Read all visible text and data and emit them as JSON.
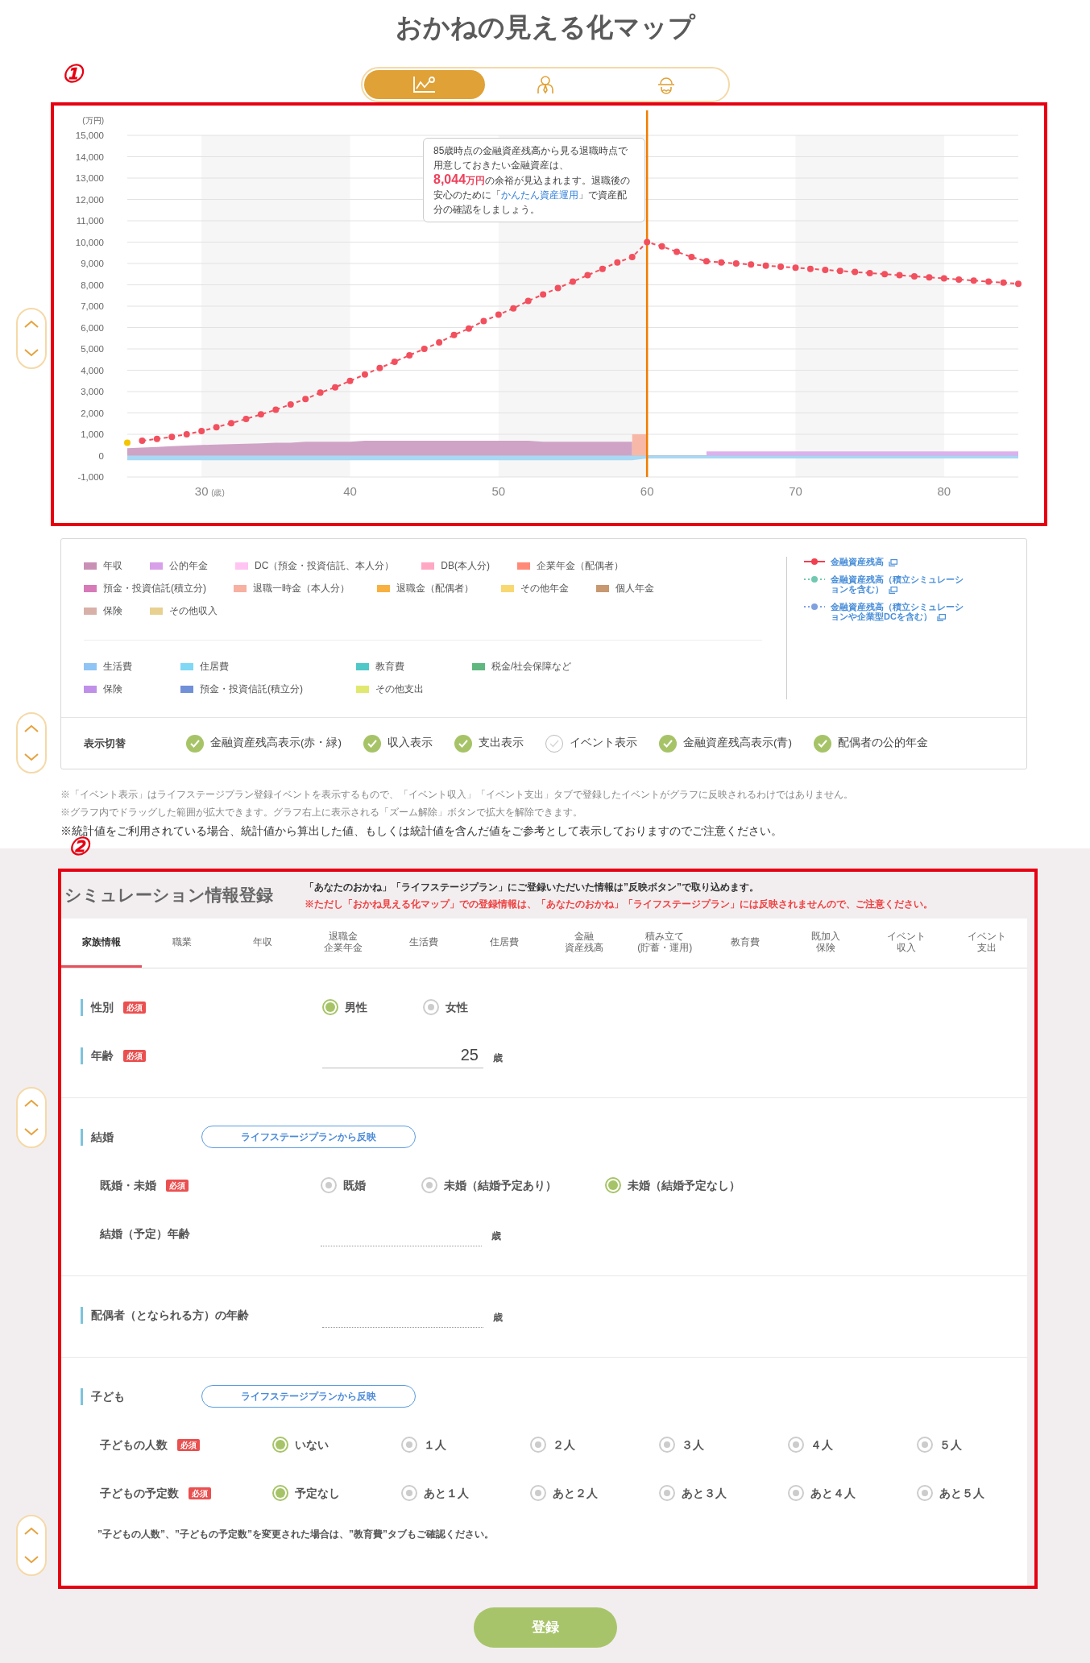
{
  "title": "おかねの見える化マップ",
  "view_tabs": [
    {
      "kind": "chart",
      "selected": true
    },
    {
      "kind": "person",
      "selected": false
    },
    {
      "kind": "advisor",
      "selected": false
    }
  ],
  "chart_section": {
    "marker": "①",
    "chart_data": {
      "type": "line",
      "xlabel": "(歳)",
      "ylabel": "(万円)",
      "stacked": false,
      "x": [
        25,
        26,
        27,
        28,
        29,
        30,
        31,
        32,
        33,
        34,
        35,
        36,
        37,
        38,
        39,
        40,
        41,
        42,
        43,
        44,
        45,
        46,
        47,
        48,
        49,
        50,
        51,
        52,
        53,
        54,
        55,
        56,
        57,
        58,
        59,
        60,
        61,
        62,
        63,
        64,
        65,
        66,
        67,
        68,
        69,
        70,
        71,
        72,
        73,
        74,
        75,
        76,
        77,
        78,
        79,
        80,
        81,
        82,
        83,
        84,
        85
      ],
      "xlim": [
        25,
        85
      ],
      "ylim": [
        -1000,
        15000
      ],
      "grid": true,
      "xticks": [
        30,
        40,
        50,
        60,
        70,
        80
      ],
      "yticks": [
        {
          "value": 15000,
          "label": "15,000"
        },
        {
          "value": 14000,
          "label": "14,000"
        },
        {
          "value": 13000,
          "label": "13,000"
        },
        {
          "value": 12000,
          "label": "12,000"
        },
        {
          "value": 11000,
          "label": "11,000"
        },
        {
          "value": 10000,
          "label": "10,000"
        },
        {
          "value": 9000,
          "label": "9,000"
        },
        {
          "value": 8000,
          "label": "8,000"
        },
        {
          "value": 7000,
          "label": "7,000"
        },
        {
          "value": 6000,
          "label": "6,000"
        },
        {
          "value": 5000,
          "label": "5,000"
        },
        {
          "value": 4000,
          "label": "4,000"
        },
        {
          "value": 3000,
          "label": "3,000"
        },
        {
          "value": 2000,
          "label": "2,000"
        },
        {
          "value": 1000,
          "label": "1,000"
        },
        {
          "value": 0,
          "label": "0"
        },
        {
          "value": -1000,
          "label": "-1,000"
        }
      ],
      "series": [
        {
          "type": "area",
          "color": "#cfa3c6",
          "values": [
            350,
            380,
            410,
            440,
            470,
            500,
            520,
            540,
            560,
            580,
            600,
            600,
            650,
            650,
            650,
            650,
            700,
            700,
            700,
            700,
            700,
            700,
            700,
            700,
            700,
            700,
            700,
            700,
            650,
            650,
            650,
            650,
            650,
            650,
            650,
            null,
            null,
            null,
            null,
            null,
            null,
            null,
            null,
            null,
            null,
            null,
            null,
            null,
            null,
            null,
            null,
            null,
            null,
            null,
            null,
            null,
            null,
            null,
            null,
            null,
            null
          ]
        },
        {
          "type": "area",
          "color": "#f8b8a8",
          "values": [
            null,
            null,
            null,
            null,
            null,
            null,
            null,
            null,
            null,
            null,
            null,
            null,
            null,
            null,
            null,
            null,
            null,
            null,
            null,
            null,
            null,
            null,
            null,
            null,
            null,
            null,
            null,
            null,
            null,
            null,
            null,
            null,
            null,
            null,
            1000,
            1000,
            null,
            null,
            null,
            null,
            null,
            null,
            null,
            null,
            null,
            null,
            null,
            null,
            null,
            null,
            null,
            null,
            null,
            null,
            null,
            null,
            null,
            null,
            null,
            null,
            null
          ]
        },
        {
          "type": "area",
          "color": "#ddb0ee",
          "values": [
            null,
            null,
            null,
            null,
            null,
            null,
            null,
            null,
            null,
            null,
            null,
            null,
            null,
            null,
            null,
            null,
            null,
            null,
            null,
            null,
            null,
            null,
            null,
            null,
            null,
            null,
            null,
            null,
            null,
            null,
            null,
            null,
            null,
            null,
            null,
            null,
            null,
            null,
            null,
            200,
            200,
            200,
            200,
            200,
            200,
            200,
            200,
            200,
            200,
            200,
            200,
            200,
            200,
            200,
            200,
            200,
            200,
            200,
            200,
            200,
            200
          ]
        },
        {
          "type": "area",
          "color": "#a8d8f4",
          "values": [
            -220,
            -220,
            -220,
            -220,
            -220,
            -220,
            -220,
            -220,
            -220,
            -220,
            -220,
            -220,
            -220,
            -220,
            -220,
            -220,
            -220,
            -220,
            -220,
            -220,
            -220,
            -220,
            -220,
            -220,
            -220,
            -220,
            -220,
            -220,
            -220,
            -220,
            -220,
            -220,
            -220,
            -220,
            -220,
            -130,
            -130,
            -130,
            -130,
            -130,
            -130,
            -130,
            -130,
            -130,
            -130,
            -130,
            -130,
            -130,
            -130,
            -130,
            -130,
            -130,
            -130,
            -130,
            -130,
            -130,
            -130,
            -130,
            -130,
            -130,
            -130
          ]
        },
        {
          "type": "scatter",
          "color": "#f5c400",
          "marker": "circle",
          "values": [
            600,
            null,
            null,
            null,
            null,
            null,
            null,
            null,
            null,
            null,
            null,
            null,
            null,
            null,
            null,
            null,
            null,
            null,
            null,
            null,
            null,
            null,
            null,
            null,
            null,
            null,
            null,
            null,
            null,
            null,
            null,
            null,
            null,
            null,
            null,
            null,
            null,
            null,
            null,
            null,
            null,
            null,
            null,
            null,
            null,
            null,
            null,
            null,
            null,
            null,
            null,
            null,
            null,
            null,
            null,
            null,
            null,
            null,
            null,
            null,
            null
          ]
        },
        {
          "type": "line",
          "color": "#f2505e",
          "line_style": "dashed",
          "marker": "circle",
          "values": [
            null,
            700,
            780,
            880,
            1000,
            1150,
            1330,
            1520,
            1720,
            1930,
            2150,
            2400,
            2650,
            2950,
            3200,
            3500,
            3800,
            4100,
            4400,
            4700,
            5000,
            5300,
            5650,
            5950,
            6300,
            6600,
            6900,
            7250,
            7550,
            7850,
            8150,
            8450,
            8750,
            9050,
            9300,
            10000,
            9800,
            9550,
            9300,
            9100,
            9050,
            9000,
            8950,
            8900,
            8850,
            8800,
            8750,
            8700,
            8650,
            8600,
            8550,
            8500,
            8450,
            8400,
            8350,
            8300,
            8250,
            8200,
            8150,
            8100,
            8050
          ]
        }
      ],
      "ref_lines": [
        {
          "axis": "x",
          "value": 60
        }
      ],
      "bands": [
        {
          "axis": "x",
          "from": 30,
          "to": 40
        },
        {
          "axis": "x",
          "from": 50,
          "to": 60
        },
        {
          "axis": "x",
          "from": 70,
          "to": 80
        }
      ]
    },
    "tooltip": {
      "intro": "85歳時点の金融資産残高から見る退職時点で用意しておきたい金融資産は、",
      "amount": "8,044",
      "amount_unit": "万円",
      "text": "の余裕が見込まれます。退職後の安心のために「",
      "link": "かんたん資産運用",
      "text_end": "」で資産配分の確認をしましょう。"
    }
  },
  "legend": {
    "income": [
      {
        "label": "年収",
        "color": "#c990b5"
      },
      {
        "label": "公的年金",
        "color": "#d7a0e8"
      },
      {
        "label": "DC（預金・投資信託、本人分）",
        "color": "#ffc4f2"
      },
      {
        "label": "DB(本人分)",
        "color": "#ffa8c4"
      },
      {
        "label": "企業年金（配偶者）",
        "color": "#ff8a78"
      },
      {
        "label": "預金・投資信託(積立分)",
        "color": "#d77ab8"
      },
      {
        "label": "退職一時金（本人分）",
        "color": "#f8b0a0"
      },
      {
        "label": "退職金（配偶者）",
        "color": "#f8b040"
      },
      {
        "label": "その他年金",
        "color": "#f8d870"
      },
      {
        "label": "個人年金",
        "color": "#c89870"
      },
      {
        "label": "保険",
        "color": "#d8b0a8"
      },
      {
        "label": "その他収入",
        "color": "#e8d090"
      }
    ],
    "expense": [
      {
        "label": "生活費",
        "color": "#90c4f4"
      },
      {
        "label": "住居費",
        "color": "#80d8f4"
      },
      {
        "label": "教育費",
        "color": "#50c8c8"
      },
      {
        "label": "税金/社会保障など",
        "color": "#60b880"
      },
      {
        "label": "保険",
        "color": "#c090e8"
      },
      {
        "label": "預金・投資信託(積立分)",
        "color": "#7090d8"
      },
      {
        "label": "その他支出",
        "color": "#e0e870"
      }
    ],
    "lines": [
      {
        "label": "金融資産残高",
        "color": "#f04050",
        "kind": "solid"
      },
      {
        "label": "金融資産残高（積立シミュレーションを含む）",
        "color": "#70c8b0",
        "kind": "dotted"
      },
      {
        "label": "金融資産残高（積立シミュレーションや企業型DCを含む）",
        "color": "#80a0e0",
        "kind": "dotted"
      }
    ],
    "toggle_label": "表示切替",
    "toggles": [
      {
        "label": "金融資産残高表示(赤・緑)",
        "checked": true
      },
      {
        "label": "収入表示",
        "checked": true
      },
      {
        "label": "支出表示",
        "checked": true
      },
      {
        "label": "イベント表示",
        "checked": false
      },
      {
        "label": "金融資産残高表示(青)",
        "checked": true
      },
      {
        "label": "配偶者の公的年金",
        "checked": true
      }
    ]
  },
  "notes": [
    {
      "kind": "small",
      "text": "※「イベント表示」はライフステージプラン登録イベントを表示するもので、「イベント収入」「イベント支出」タブで登録したイベントがグラフに反映されるわけではありません。"
    },
    {
      "kind": "small",
      "text": "※グラフ内でドラッグした範囲が拡大できます。グラフ右上に表示される「ズーム解除」ボタンで拡大を解除できます。"
    },
    {
      "kind": "large",
      "text": "※統計値をご利用されている場合、統計値から算出した値、もしくは統計値を含んだ値をご参考として表示しておりますのでご注意ください。"
    }
  ],
  "form_section": {
    "marker": "②",
    "title": "シミュレーション情報登録",
    "notice": "「あなたのおかね」「ライフステージプラン」にご登録いただいた情報は”反映ボタン”で取り込めます。",
    "warning": "※ただし「おかね見える化マップ」での登録情報は、「あなたのおかね」「ライフステージプラン」には反映されませんので、ご注意ください。",
    "tabs": [
      {
        "label": "家族情報",
        "selected": true
      },
      {
        "label": "職業",
        "selected": false
      },
      {
        "label": "年収",
        "selected": false
      },
      {
        "label": [
          "退職金",
          "企業年金"
        ],
        "selected": false
      },
      {
        "label": "生活費",
        "selected": false
      },
      {
        "label": "住居費",
        "selected": false
      },
      {
        "label": [
          "金融",
          "資産残高"
        ],
        "selected": false
      },
      {
        "label": [
          "積み立て",
          "(貯蓄・運用)"
        ],
        "selected": false
      },
      {
        "label": "教育費",
        "selected": false
      },
      {
        "label": [
          "既加入",
          "保険"
        ],
        "selected": false
      },
      {
        "label": [
          "イベント",
          "収入"
        ],
        "selected": false
      },
      {
        "label": [
          "イベント",
          "支出"
        ],
        "selected": false
      }
    ],
    "groups": [
      {
        "fields": [
          {
            "kind": "radio",
            "label": "性別",
            "badge": "必須",
            "options": [
              {
                "label": "男性",
                "selected": true
              },
              {
                "label": "女性",
                "selected": false
              }
            ]
          },
          {
            "kind": "number",
            "label": "年齢",
            "badge": "必須",
            "value": "25",
            "unit": "歳"
          }
        ]
      },
      {
        "heading": {
          "label": "結婚",
          "button": "ライフステージプランから反映"
        },
        "fields": [
          {
            "kind": "radio",
            "label": "既婚・未婚",
            "badge": "必須",
            "options": [
              {
                "label": "既婚",
                "selected": false
              },
              {
                "label": "未婚（結婚予定あり）",
                "selected": false
              },
              {
                "label": "未婚（結婚予定なし）",
                "selected": true
              }
            ]
          },
          {
            "kind": "number",
            "label": "結婚（予定）年齢",
            "unit": "歳"
          }
        ]
      },
      {
        "fields": [
          {
            "kind": "number",
            "label": "配偶者（となられる方）の年齢",
            "unit": "歳"
          }
        ]
      },
      {
        "heading": {
          "label": "子ども",
          "button": "ライフステージプランから反映"
        },
        "fields": [
          {
            "kind": "radio",
            "label": "子どもの人数",
            "badge": "必須",
            "options": [
              {
                "label": "いない",
                "selected": true
              },
              {
                "label": "１人",
                "selected": false
              },
              {
                "label": "２人",
                "selected": false
              },
              {
                "label": "３人",
                "selected": false
              },
              {
                "label": "４人",
                "selected": false
              },
              {
                "label": "５人",
                "selected": false
              }
            ]
          },
          {
            "kind": "radio",
            "label": "子どもの予定数",
            "badge": "必須",
            "options": [
              {
                "label": "予定なし",
                "selected": true
              },
              {
                "label": "あと１人",
                "selected": false
              },
              {
                "label": "あと２人",
                "selected": false
              },
              {
                "label": "あと３人",
                "selected": false
              },
              {
                "label": "あと４人",
                "selected": false
              },
              {
                "label": "あと５人",
                "selected": false
              }
            ]
          }
        ],
        "note": "”子どもの人数”、”子どもの予定数”を変更された場合は、”教育費”タブもご確認ください。"
      }
    ]
  },
  "submit": "登録"
}
